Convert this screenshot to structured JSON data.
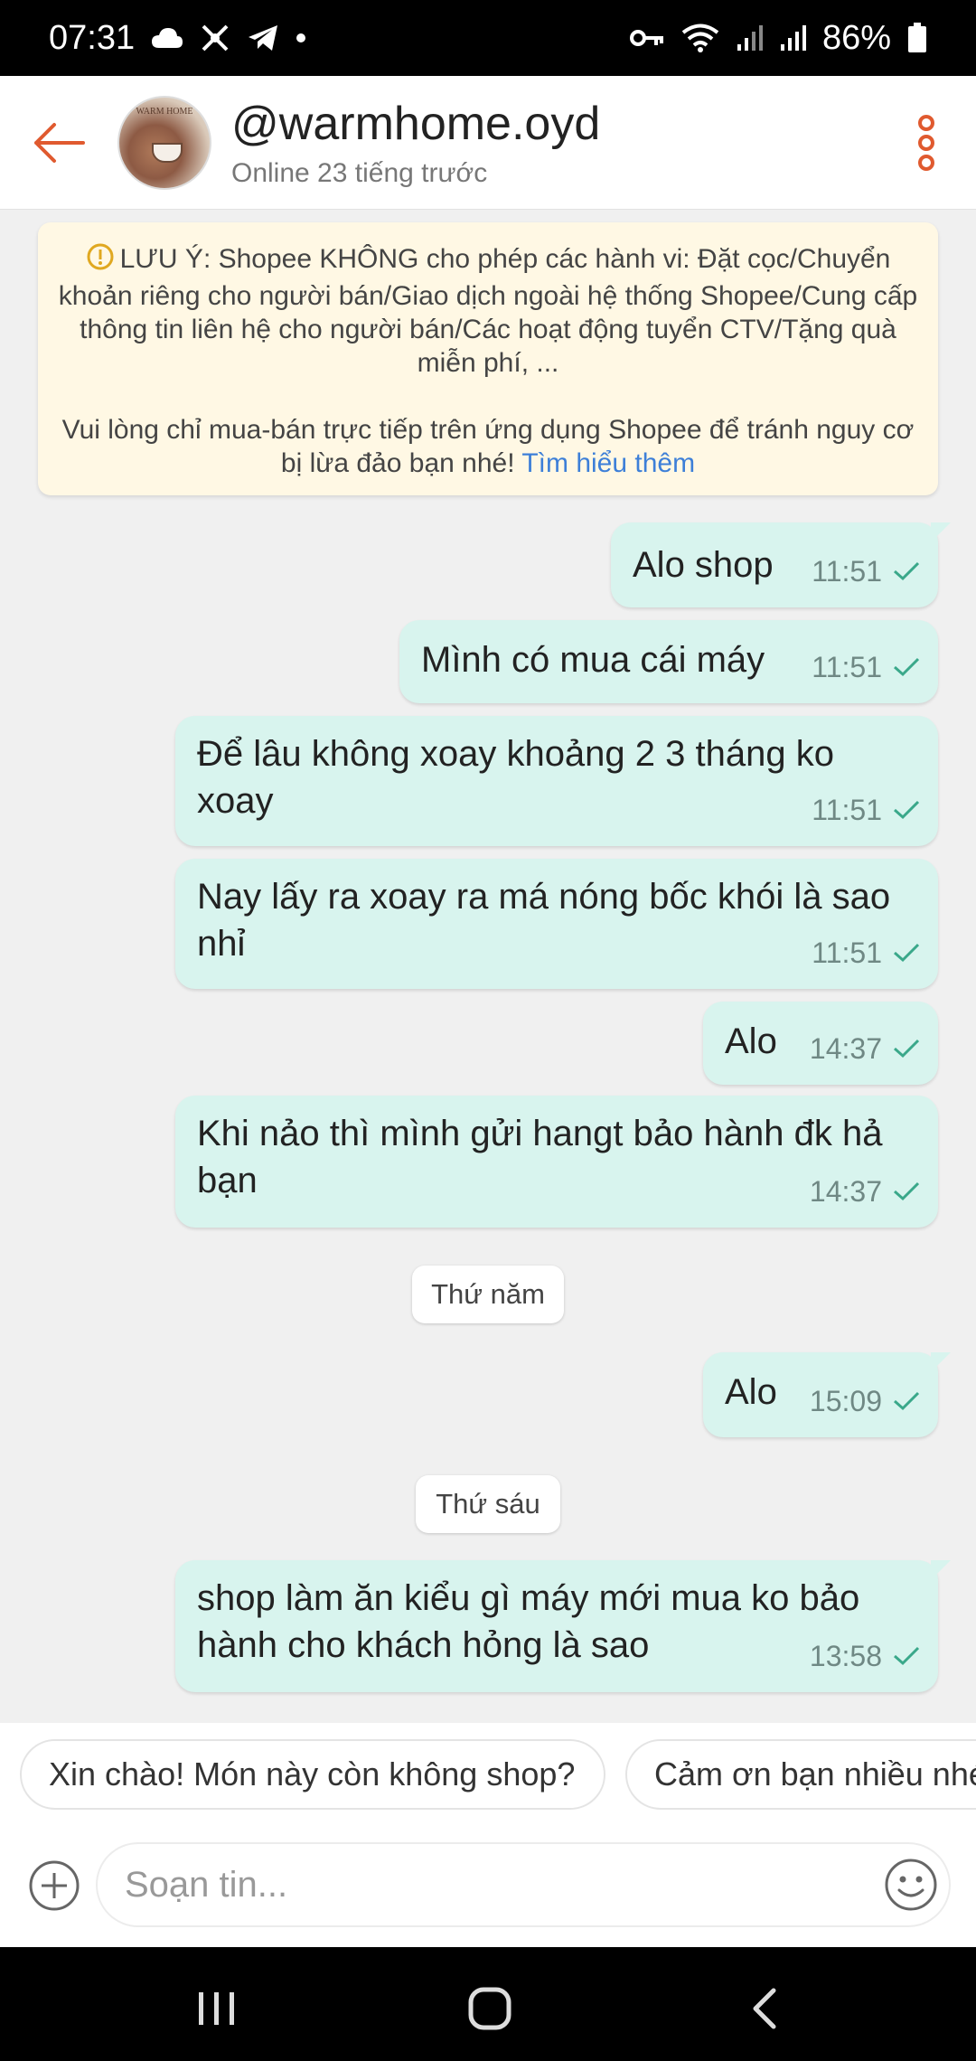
{
  "status_bar": {
    "time": "07:31",
    "battery": "86%",
    "icons_left": [
      "cloud-icon",
      "missed-call-icon",
      "telegram-icon",
      "dot-icon"
    ],
    "icons_right": [
      "vpn-key-icon",
      "wifi-icon",
      "signal-icon",
      "signal-icon",
      "battery-icon"
    ]
  },
  "header": {
    "title": "@warmhome.oyd",
    "subtitle": "Online 23 tiếng trước",
    "avatar_text": "WARM HOME",
    "accent_color": "#e05a2f"
  },
  "notice": {
    "p1": "LƯU Ý: Shopee KHÔNG cho phép các hành vi: Đặt cọc/Chuyển khoản riêng cho người bán/Giao dịch ngoài hệ thống Shopee/Cung cấp thông tin liên hệ cho người bán/Các hoạt động tuyển CTV/Tặng quà miễn phí, ...",
    "p2": "Vui lòng chỉ mua-bán trực tiếp trên ứng dụng Shopee để tránh nguy cơ bị lừa đảo bạn nhé!",
    "link": "Tìm hiểu thêm",
    "background": "#fff8e4"
  },
  "messages": [
    {
      "text": "Alo shop",
      "time": "11:51"
    },
    {
      "text": "Mình có mua cái máy",
      "time": "11:51"
    },
    {
      "text": "Để lâu không xoay khoảng 2 3 tháng ko xoay",
      "time": "11:51"
    },
    {
      "text": "Nay lấy ra xoay ra má nóng bốc khói là sao nhỉ",
      "time": "11:51"
    },
    {
      "text": "Alo",
      "time": "14:37"
    },
    {
      "text": "Khi nảo thì mình gửi hangt bảo hành đk hả bạn",
      "time": "14:37"
    },
    {
      "text": "Alo",
      "time": "15:09"
    },
    {
      "text": "shop  làm ăn kiểu gì máy mới mua ko bảo hành cho khách hỏng là sao",
      "time": "13:58"
    }
  ],
  "day_separators": [
    "Thứ năm",
    "Thứ sáu"
  ],
  "quick_replies": [
    "Xin chào! Món này còn không shop?",
    "Cảm ơn bạn nhiều nhé"
  ],
  "compose": {
    "placeholder": "Soạn tin..."
  },
  "colors": {
    "bubble": "#d8f4ee",
    "tick": "#3aa88a",
    "background": "#f0f0f0"
  }
}
